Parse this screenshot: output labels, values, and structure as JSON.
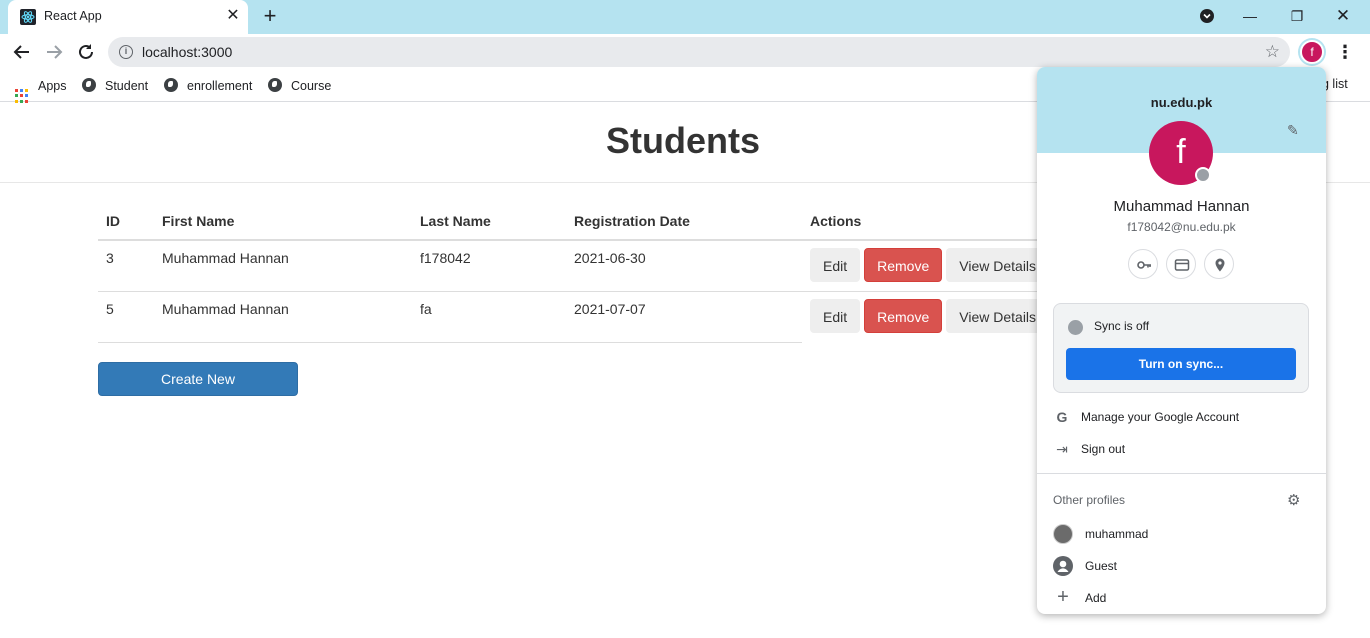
{
  "browser": {
    "tab_title": "React App",
    "url": "localhost:3000",
    "profile_initial": "f",
    "bookmarks": [
      "Apps",
      "Student",
      "enrollement",
      "Course"
    ],
    "reading_list_partial": "g list"
  },
  "page": {
    "title": "Students",
    "table": {
      "headers": [
        "ID",
        "First Name",
        "Last Name",
        "Registration Date",
        "Actions"
      ],
      "rows": [
        {
          "id": "3",
          "first": "Muhammad Hannan",
          "last": "f178042",
          "date": "2021-06-30"
        },
        {
          "id": "5",
          "first": "Muhammad Hannan",
          "last": "fa",
          "date": "2021-07-07"
        }
      ],
      "actions": {
        "edit": "Edit",
        "remove": "Remove",
        "view": "View Details"
      }
    },
    "create_label": "Create New"
  },
  "profile_popup": {
    "domain": "nu.edu.pk",
    "avatar_initial": "f",
    "name": "Muhammad Hannan",
    "email": "f178042@nu.edu.pk",
    "sync_status": "Sync is off",
    "turn_on_sync": "Turn on sync...",
    "manage_account": "Manage your Google Account",
    "sign_out": "Sign out",
    "other_profiles": "Other profiles",
    "profiles": [
      "muhammad",
      "Guest",
      "Add"
    ]
  },
  "colors": {
    "tabstrip": "#b5e3f0",
    "avatar": "#c8175d",
    "danger": "#d9534f",
    "primary": "#337ab7",
    "sync_button": "#1a73e8"
  }
}
